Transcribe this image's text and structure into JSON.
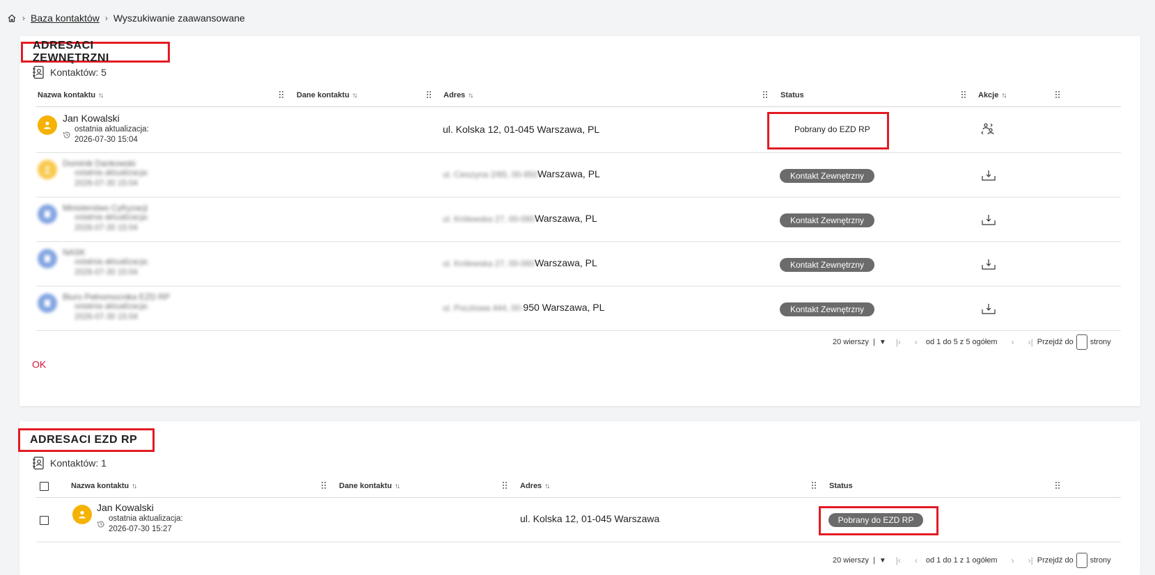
{
  "breadcrumb": {
    "home_icon": "home-icon",
    "link": "Baza kontaktów",
    "current": "Wyszukiwanie zaawansowane"
  },
  "section1": {
    "title": "ADRESACI ZEWNĘTRZNI",
    "count_label": "Kontaktów: 5",
    "columns": [
      "Nazwa kontaktu",
      "Dane kontaktu",
      "Adres",
      "Status",
      "Akcje"
    ],
    "rows": [
      {
        "name": "Jan Kowalski",
        "upd_label": "ostatnia aktualizacja:",
        "upd_date": "2026-07-30 15:04",
        "address": "ul. Kolska 12, 01-045 Warszawa, PL",
        "status": "Pobrany do EZD RP",
        "action_icon": "people-exchange-icon"
      },
      {
        "name": "Dominik Dankowski",
        "upd_label": "ostatnia aktualizacja:",
        "upd_date": "2026-07-30 15:04",
        "address_blur": "ul. Cieszyna 2/65, 00-950",
        "address": "Warszawa, PL",
        "status": "Kontakt Zewnętrzny",
        "action_icon": "download-tray-icon"
      },
      {
        "name": "Ministerstwo Cyfryzacji",
        "upd_label": "ostatnia aktualizacja:",
        "upd_date": "2026-07-30 15:04",
        "address_blur": "ul. Królewska 27, 00-060",
        "address": "Warszawa, PL",
        "status": "Kontakt Zewnętrzny",
        "action_icon": "download-tray-icon"
      },
      {
        "name": "NASK",
        "upd_label": "ostatnia aktualizacja:",
        "upd_date": "2026-07-30 15:04",
        "address_blur": "ul. Królewska 27, 00-060",
        "address": "Warszawa, PL",
        "status": "Kontakt Zewnętrzny",
        "action_icon": "download-tray-icon"
      },
      {
        "name": "Biuro Pełnomocnika EZD RP",
        "upd_label": "ostatnia aktualizacja:",
        "upd_date": "2026-07-30 15:04",
        "address_blur": "ul. Pocztowa 444, 00-",
        "address": "950 Warszawa, PL",
        "status": "Kontakt Zewnętrzny",
        "action_icon": "download-tray-icon"
      }
    ],
    "pager": {
      "rows_per_page": "20 wierszy",
      "range": "od 1 do 5 z 5 ogółem",
      "goto_prefix": "Przejdź do",
      "goto_suffix": "strony"
    },
    "ok_label": "OK"
  },
  "section2": {
    "title": "ADRESACI EZD RP",
    "count_label": "Kontaktów: 1",
    "columns": [
      "Nazwa kontaktu",
      "Dane kontaktu",
      "Adres",
      "Status"
    ],
    "rows": [
      {
        "name": "Jan Kowalski",
        "upd_label": "ostatnia aktualizacja:",
        "upd_date": "2026-07-30 15:27",
        "address": "ul. Kolska 12, 01-045 Warszawa",
        "status": "Pobrany do EZD RP"
      }
    ],
    "pager": {
      "rows_per_page": "20 wierszy",
      "range": "od 1 do 1 z 1 ogółem",
      "goto_prefix": "Przejdź do",
      "goto_suffix": "strony"
    }
  },
  "colors": {
    "accent_red": "#e31b23",
    "pill_gray": "#6b6b6b",
    "avatar_yellow": "#f6b200",
    "avatar_blue": "#4f7fd6",
    "ok_red": "#d6133a"
  }
}
